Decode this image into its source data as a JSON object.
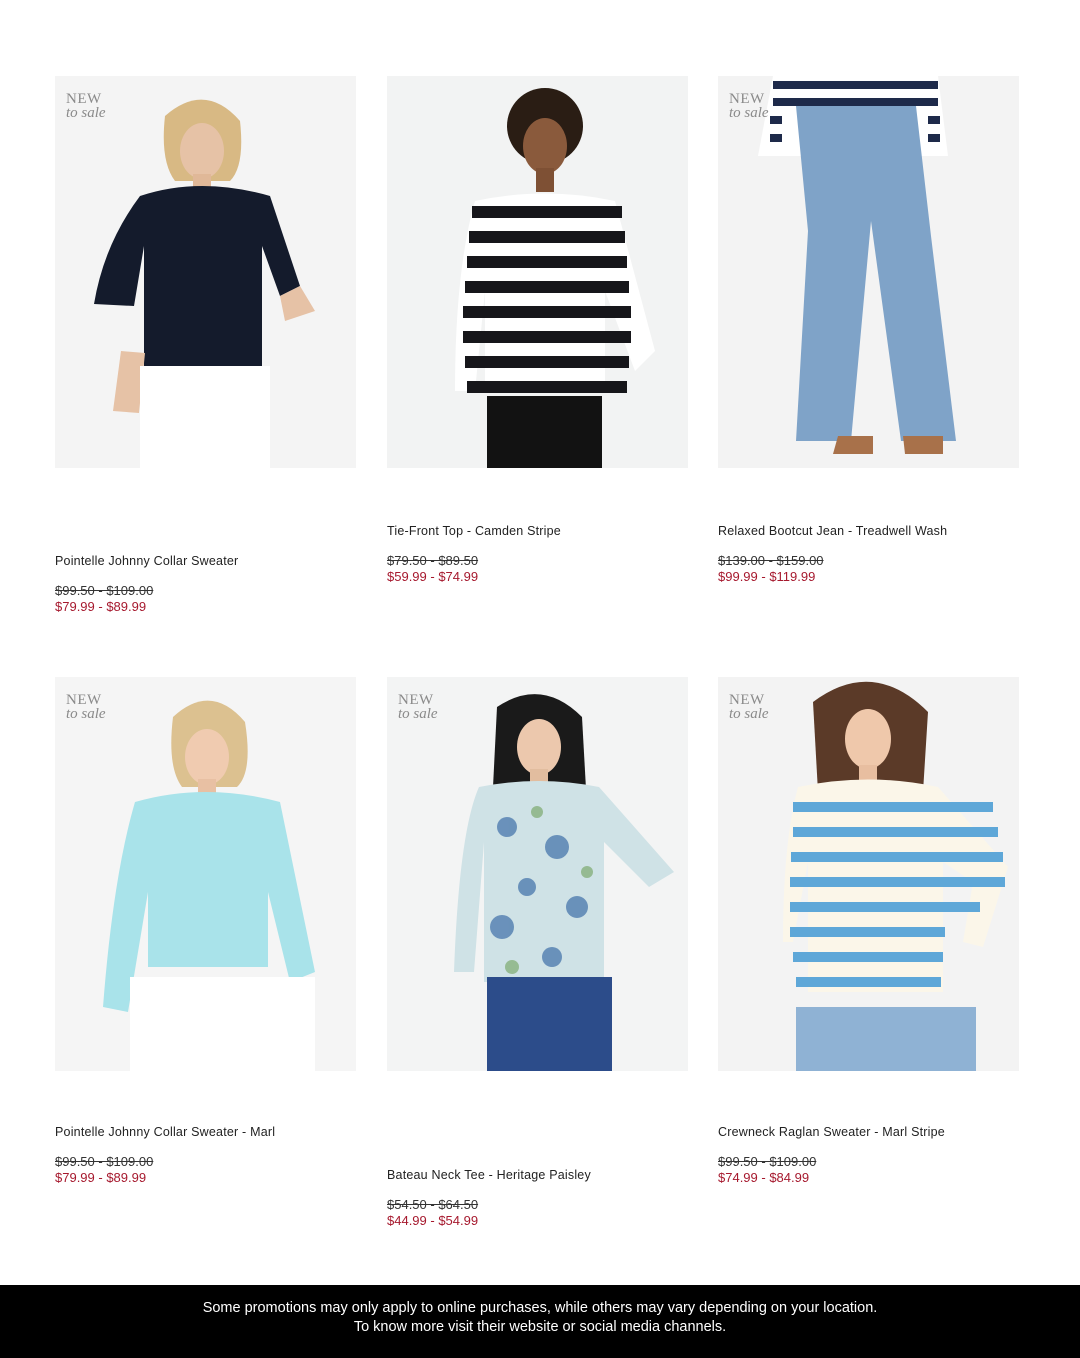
{
  "badge": {
    "line1": "NEW",
    "line2": "to sale"
  },
  "products": [
    {
      "name": "Pointelle Johnny Collar Sweater",
      "was": "$99.50 - $109.00",
      "now": "$79.99 - $89.99",
      "badge": true
    },
    {
      "name": "Tie-Front Top - Camden Stripe",
      "was": "$79.50 - $89.50",
      "now": "$59.99 - $74.99",
      "badge": false
    },
    {
      "name": "Relaxed Bootcut Jean - Treadwell Wash",
      "was": "$139.00 - $159.00",
      "now": "$99.99 - $119.99",
      "badge": true
    },
    {
      "name": "Pointelle Johnny Collar Sweater - Marl",
      "was": "$99.50 - $109.00",
      "now": "$79.99 - $89.99",
      "badge": true
    },
    {
      "name": "Bateau Neck Tee - Heritage Paisley",
      "was": "$54.50 - $64.50",
      "now": "$44.99 - $54.99",
      "badge": true
    },
    {
      "name": "Crewneck Raglan Sweater - Marl Stripe",
      "was": "$99.50 - $109.00",
      "now": "$74.99 - $84.99",
      "badge": true
    }
  ],
  "footer": {
    "line1": "Some promotions may only apply to online purchases, while others may vary depending on your location.",
    "line2": "To know more visit their website or social media channels."
  },
  "colors": {
    "sale": "#a6192e",
    "footer_bg": "#000000"
  }
}
